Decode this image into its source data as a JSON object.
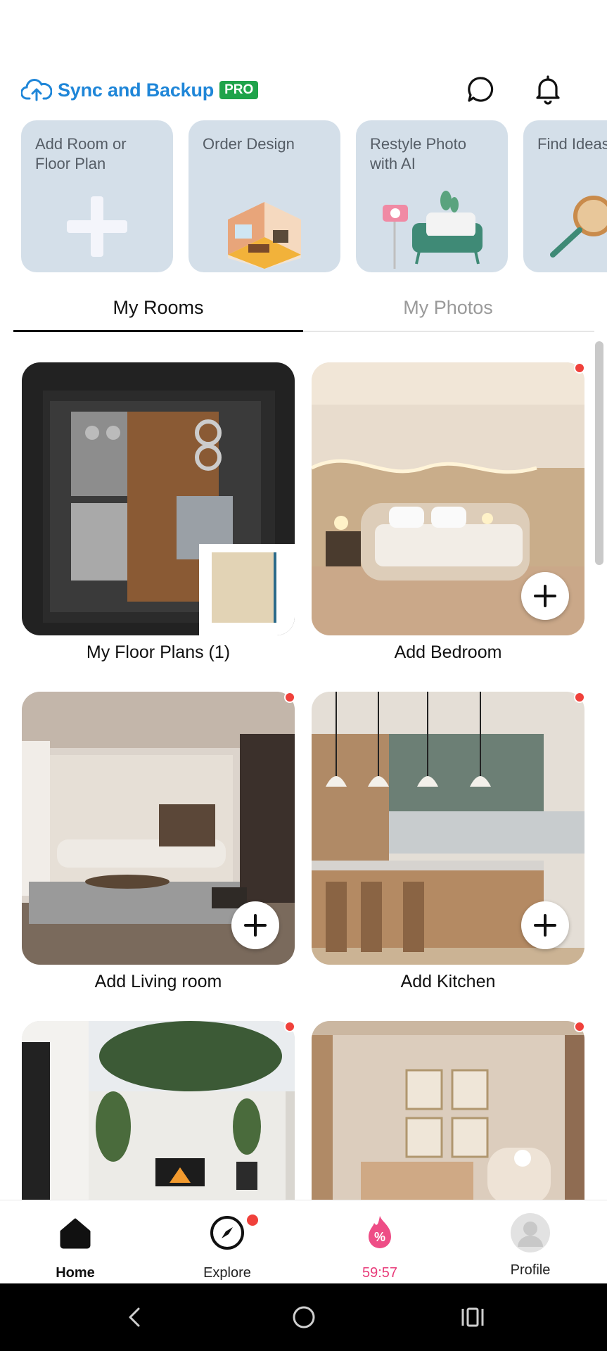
{
  "header": {
    "sync_label": "Sync and Backup",
    "pro_badge": "PRO",
    "icons": [
      "cloud-upload-icon",
      "chat-bubble-icon",
      "bell-icon"
    ]
  },
  "actions": [
    {
      "title": "Add Room or\nFloor Plan",
      "icon": "plus-icon"
    },
    {
      "title": "Order Design",
      "icon": "isometric-room-icon"
    },
    {
      "title": "Restyle Photo\nwith AI",
      "icon": "camera-sofa-icon"
    },
    {
      "title": "Find Ideas",
      "icon": "magnifier-icon"
    }
  ],
  "tabs": [
    {
      "label": "My Rooms",
      "active": true
    },
    {
      "label": "My Photos",
      "active": false
    }
  ],
  "rooms": [
    {
      "label": "My Floor Plans (1)",
      "kind": "floor-plan",
      "has_plus": false,
      "has_dot": false
    },
    {
      "label": "Add Bedroom",
      "kind": "bedroom",
      "has_plus": true,
      "has_dot": true
    },
    {
      "label": "Add Living room",
      "kind": "living-room",
      "has_plus": true,
      "has_dot": true
    },
    {
      "label": "Add Kitchen",
      "kind": "kitchen",
      "has_plus": true,
      "has_dot": true
    },
    {
      "label": "",
      "kind": "outdoor",
      "has_plus": false,
      "has_dot": true
    },
    {
      "label": "",
      "kind": "nursery",
      "has_plus": false,
      "has_dot": true
    }
  ],
  "bottom_nav": [
    {
      "label": "Home",
      "icon": "home-icon",
      "active": true
    },
    {
      "label": "Explore",
      "icon": "compass-icon",
      "badge": true
    },
    {
      "label": "59:57",
      "icon": "discount-flame-icon",
      "color": "#e83c7a"
    },
    {
      "label": "Profile",
      "icon": "avatar-icon"
    }
  ],
  "colors": {
    "accent_blue": "#1f86d8",
    "pro_green": "#1fa34a",
    "card_bg": "#d4dfe9",
    "badge_red": "#f0413b",
    "deal_pink": "#e83c7a"
  }
}
